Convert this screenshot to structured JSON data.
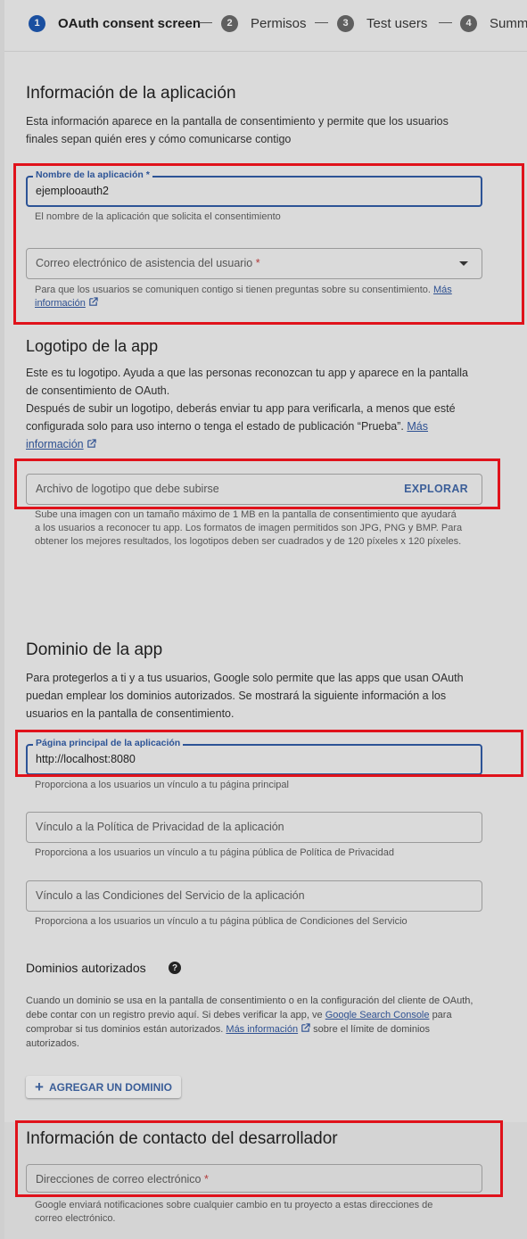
{
  "stepper": {
    "steps": [
      {
        "num": "1",
        "label": "OAuth consent screen"
      },
      {
        "num": "2",
        "label": "Permisos"
      },
      {
        "num": "3",
        "label": "Test users"
      },
      {
        "num": "4",
        "label": "Summ"
      }
    ]
  },
  "app_info": {
    "title": "Información de la aplicación",
    "description": "Esta información aparece en la pantalla de consentimiento y permite que los usuarios finales sepan quién eres y cómo comunicarse contigo",
    "app_name": {
      "label": "Nombre de la aplicación",
      "required_mark": "*",
      "value": "ejemplooauth2",
      "hint": "El nombre de la aplicación que solicita el consentimiento"
    },
    "support_email": {
      "placeholder": "Correo electrónico de asistencia del usuario",
      "required_mark": "*",
      "hint": "Para que los usuarios se comuniquen contigo si tienen preguntas sobre su consentimiento.",
      "link": "Más información"
    }
  },
  "logo": {
    "title": "Logotipo de la app",
    "description_1": "Este es tu logotipo. Ayuda a que las personas reconozcan tu app y aparece en la pantalla de consentimiento de OAuth.",
    "description_2": "Después de subir un logotipo, deberás enviar tu app para verificarla, a menos que esté configurada solo para uso interno o tenga el estado de publicación “Prueba”.",
    "link": "Más información",
    "file_placeholder": "Archivo de logotipo que debe subirse",
    "browse_label": "EXPLORAR",
    "hint": "Sube una imagen con un tamaño máximo de 1 MB en la pantalla de consentimiento que ayudará a los usuarios a reconocer tu app. Los formatos de imagen permitidos son JPG, PNG y BMP. Para obtener los mejores resultados, los logotipos deben ser cuadrados y de 120 píxeles x 120 píxeles."
  },
  "domain": {
    "title": "Dominio de la app",
    "description": "Para protegerlos a ti y a tus usuarios, Google solo permite que las apps que usan OAuth puedan emplear los dominios autorizados. Se mostrará la siguiente información a los usuarios en la pantalla de consentimiento.",
    "homepage": {
      "label": "Página principal de la aplicación",
      "value": "http://localhost:8080",
      "hint": "Proporciona a los usuarios un vínculo a tu página principal"
    },
    "privacy": {
      "placeholder": "Vínculo a la Política de Privacidad de la aplicación",
      "hint": "Proporciona a los usuarios un vínculo a tu página pública de Política de Privacidad"
    },
    "terms": {
      "placeholder": "Vínculo a las Condiciones del Servicio de la aplicación",
      "hint": "Proporciona a los usuarios un vínculo a tu página pública de Condiciones del Servicio"
    }
  },
  "authorized_domains": {
    "title": "Dominios autorizados",
    "help_glyph": "?",
    "text_1": "Cuando un dominio se usa en la pantalla de consentimiento o en la configuración del cliente de OAuth, debe contar con un registro previo aquí. Si debes verificar la app, ve",
    "console_link": "Google Search Console",
    "text_2": "para comprobar si tus dominios están autorizados.",
    "more_link": "Más información",
    "text_3": "sobre el límite de dominios autorizados.",
    "add_button": "AGREGAR UN DOMINIO",
    "add_glyph": "+"
  },
  "developer": {
    "title": "Información de contacto del desarrollador",
    "email_placeholder": "Direcciones de correo electrónico",
    "required_mark": "*",
    "hint": "Google enviará notificaciones sobre cualquier cambio en tu proyecto a estas direcciones de correo electrónico."
  },
  "colors": {
    "accent": "#2c5396",
    "highlight": "#e0121b",
    "required": "#b23a3a"
  }
}
